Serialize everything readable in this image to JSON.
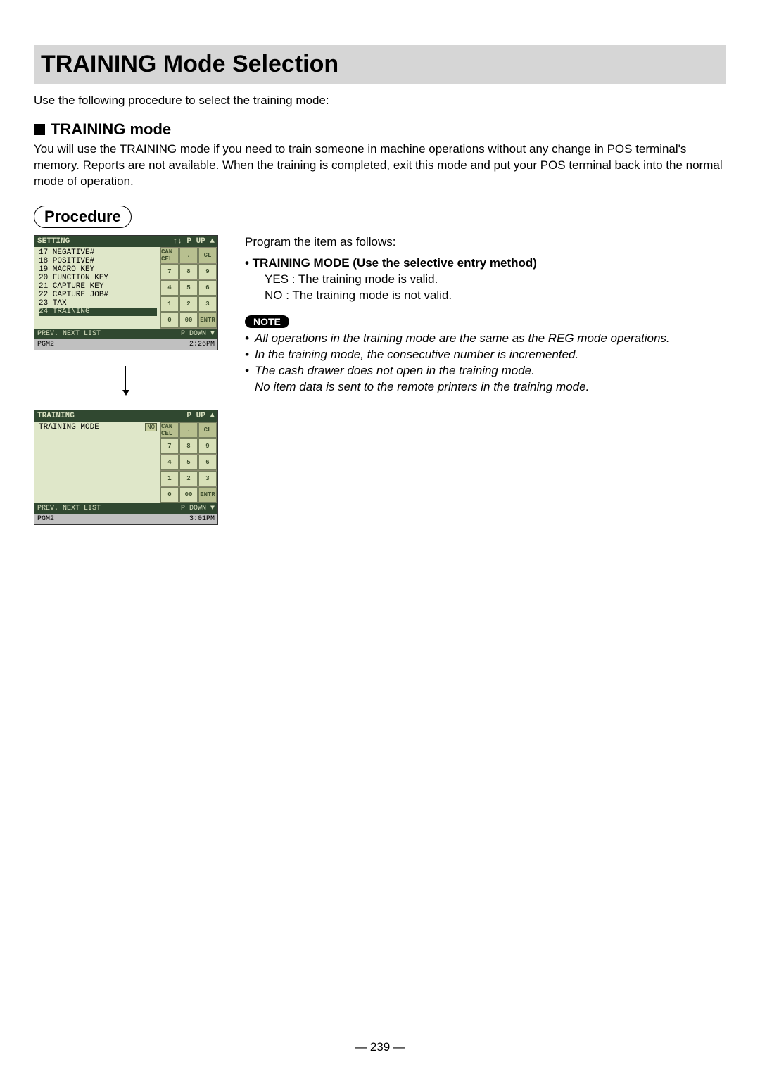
{
  "title": "TRAINING Mode Selection",
  "intro": "Use the following procedure to select the training mode:",
  "section_heading": "TRAINING mode",
  "section_para": "You will use the TRAINING mode if you need to train someone in machine operations without any change in POS terminal's memory. Reports are not available. When the training is completed, exit this mode and put your POS terminal back into the normal mode of operation.",
  "procedure_label": "Procedure",
  "screens": {
    "s1": {
      "hdr_left": "SETTING",
      "hdr_right": "↑↓  P UP  ▲",
      "items": [
        "17 NEGATIVE#",
        "18 POSITIVE#",
        "19 MACRO KEY",
        "20 FUNCTION KEY",
        "21 CAPTURE KEY",
        "22 CAPTURE JOB#",
        "23 TAX",
        "24 TRAINING"
      ],
      "selected_index": 7,
      "ftr": {
        "prev": "PREV.",
        "next": "NEXT",
        "list": "LIST",
        "pdown": "P DOWN ▼"
      },
      "status_left": "PGM2",
      "status_right": "2:26PM"
    },
    "s2": {
      "hdr_left": "TRAINING",
      "hdr_right": "P UP  ▲",
      "line": "TRAINING MODE",
      "tag": "NO",
      "ftr": {
        "prev": "PREV.",
        "next": "NEXT",
        "list": "LIST",
        "pdown": "P DOWN ▼"
      },
      "status_left": "PGM2",
      "status_right": "3:01PM"
    }
  },
  "keypad": {
    "r1": [
      "CAN CEL",
      ".",
      "CL"
    ],
    "r2": [
      "7",
      "8",
      "9"
    ],
    "r3": [
      "4",
      "5",
      "6"
    ],
    "r4": [
      "1",
      "2",
      "3"
    ],
    "r5": [
      "0",
      "00",
      "ENTR"
    ]
  },
  "right": {
    "lead": "Program the item as follows:",
    "bullet": "• TRAINING MODE (Use the selective entry method)",
    "yes": "YES :  The training mode is valid.",
    "no": "NO   :  The training mode is not valid."
  },
  "note_label": "NOTE",
  "notes": [
    "All operations in the training mode are the same as the REG mode operations.",
    "In the training mode, the consecutive number is incremented.",
    "The cash drawer does not open in the training mode.",
    "No item data is sent to the remote printers in the training mode."
  ],
  "page_number": "— 239 —"
}
